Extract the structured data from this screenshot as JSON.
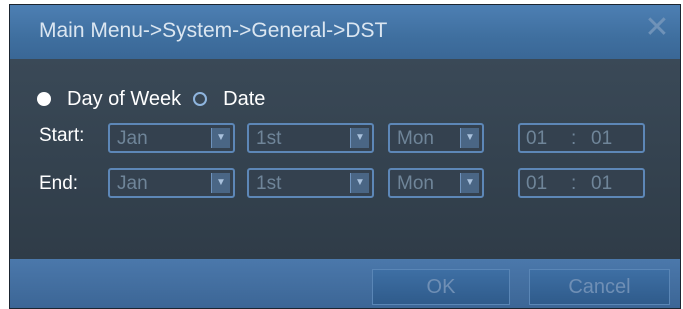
{
  "dialog": {
    "title": "Main Menu->System->General->DST",
    "close_glyph": "✕"
  },
  "mode": {
    "options": [
      {
        "label": "Day of Week",
        "selected": true
      },
      {
        "label": "Date",
        "selected": false
      }
    ]
  },
  "start": {
    "label": "Start:",
    "month": "Jan",
    "week": "1st",
    "day": "Mon",
    "hour": "01",
    "separator": ":",
    "minute": "01"
  },
  "end": {
    "label": "End:",
    "month": "Jan",
    "week": "1st",
    "day": "Mon",
    "hour": "01",
    "separator": ":",
    "minute": "01"
  },
  "buttons": {
    "ok": "OK",
    "cancel": "Cancel"
  },
  "icons": {
    "dropdown": "chevron-down-icon",
    "close": "close-icon"
  },
  "colors": {
    "titlebar": "#4a7aad",
    "body": "#34424f",
    "field_border": "#5d87b7",
    "disabled_text": "#6f8599"
  }
}
